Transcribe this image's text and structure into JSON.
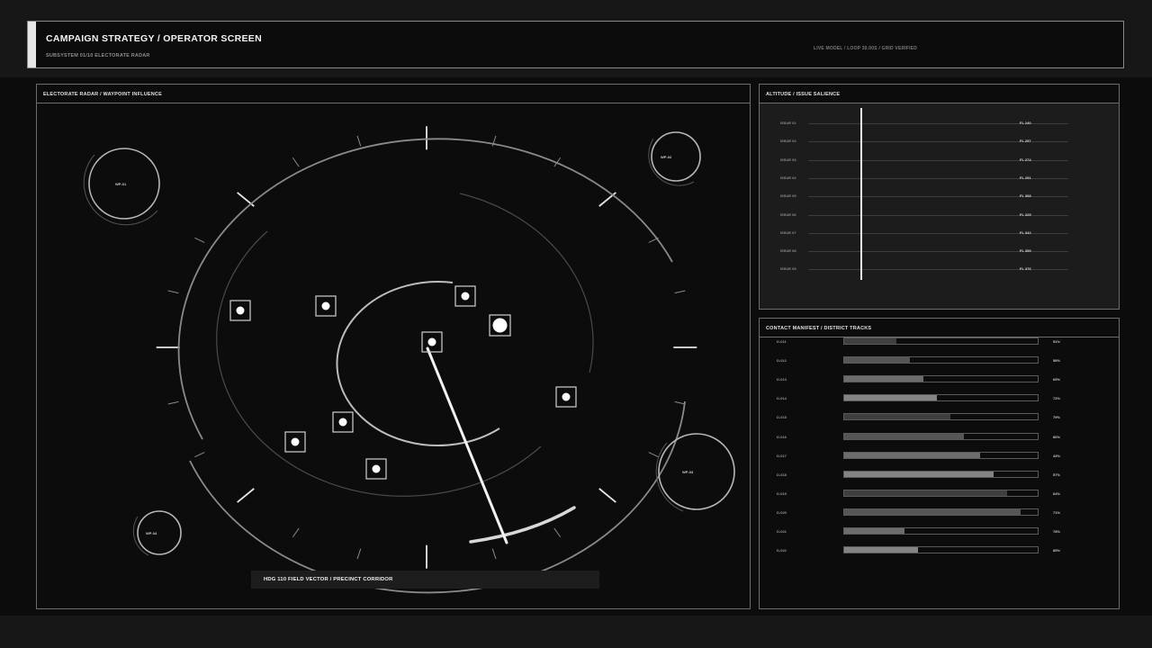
{
  "header": {
    "title": "CAMPAIGN STRATEGY / OPERATOR SCREEN",
    "subtitle": "SUBSYSTEM 01/10  ELECTORATE RADAR",
    "status": "LIVE MODEL / LOOP 30.00S / GRID VERIFIED"
  },
  "radar": {
    "title": "ELECTORATE RADAR / WAYPOINT INFLUENCE",
    "callout": "HDG 110  FIELD VECTOR / PRECINCT CORRIDOR",
    "heading_deg": 110,
    "waypoints": [
      "WP-01",
      "WP-02",
      "WP-03",
      "WP-04"
    ]
  },
  "salience": {
    "title": "ALTITUDE / ISSUE SALIENCE",
    "rows": [
      {
        "label": "ISSUE 01",
        "value": "FL 240"
      },
      {
        "label": "ISSUE 02",
        "value": "FL 257"
      },
      {
        "label": "ISSUE 03",
        "value": "FL 274"
      },
      {
        "label": "ISSUE 04",
        "value": "FL 291"
      },
      {
        "label": "ISSUE 05",
        "value": "FL 308"
      },
      {
        "label": "ISSUE 06",
        "value": "FL 325"
      },
      {
        "label": "ISSUE 07",
        "value": "FL 342"
      },
      {
        "label": "ISSUE 08",
        "value": "FL 359"
      },
      {
        "label": "ISSUE 09",
        "value": "FL 376"
      }
    ]
  },
  "manifest": {
    "title": "CONTACT MANIFEST / DISTRICT TRACKS",
    "rows": [
      {
        "label": "D-011",
        "pct": "51%",
        "level": 0.27,
        "color": "#3e3f3e"
      },
      {
        "label": "D-012",
        "pct": "58%",
        "level": 0.34,
        "color": "#555655"
      },
      {
        "label": "D-013",
        "pct": "65%",
        "level": 0.41,
        "color": "#6c6d6c"
      },
      {
        "label": "D-014",
        "pct": "72%",
        "level": 0.48,
        "color": "#838483"
      },
      {
        "label": "D-015",
        "pct": "79%",
        "level": 0.55,
        "color": "#3e3f3e"
      },
      {
        "label": "D-016",
        "pct": "86%",
        "level": 0.62,
        "color": "#555655"
      },
      {
        "label": "D-017",
        "pct": "43%",
        "level": 0.7,
        "color": "#6c6d6c"
      },
      {
        "label": "D-018",
        "pct": "57%",
        "level": 0.77,
        "color": "#838483"
      },
      {
        "label": "D-019",
        "pct": "64%",
        "level": 0.84,
        "color": "#3e3f3e"
      },
      {
        "label": "D-020",
        "pct": "71%",
        "level": 0.91,
        "color": "#555655"
      },
      {
        "label": "D-021",
        "pct": "78%",
        "level": 0.31,
        "color": "#6c6d6c"
      },
      {
        "label": "D-022",
        "pct": "85%",
        "level": 0.38,
        "color": "#838483"
      }
    ]
  }
}
